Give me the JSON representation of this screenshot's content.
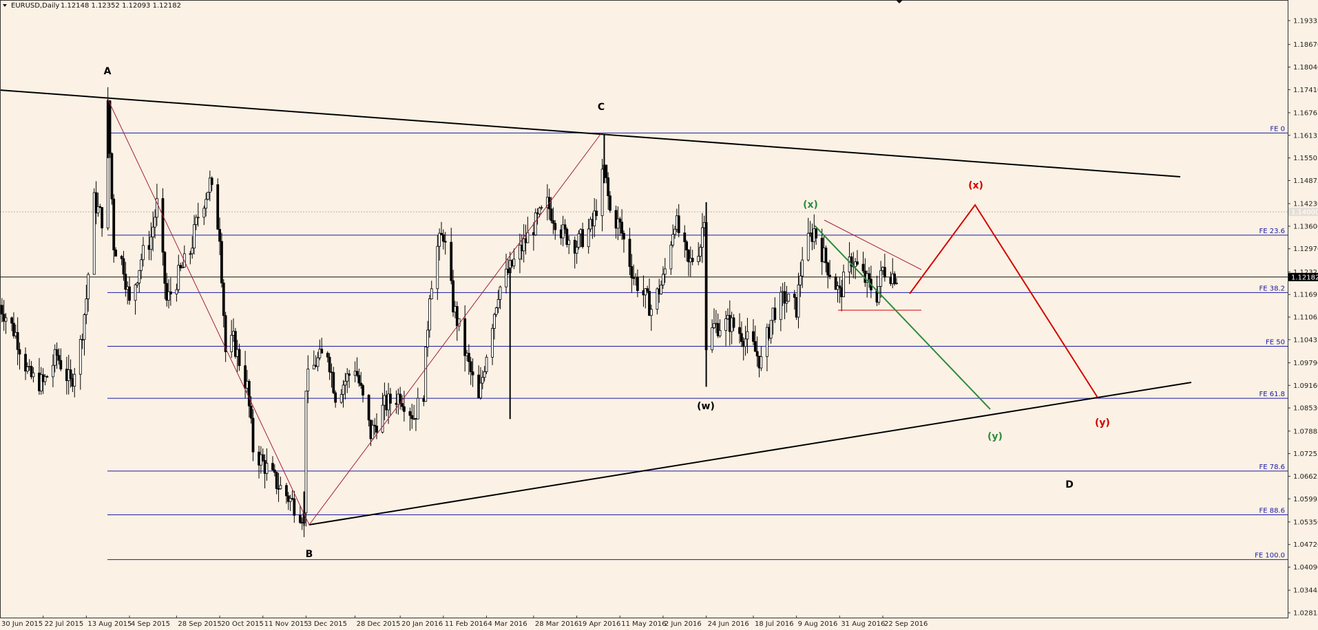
{
  "header": {
    "symbol": "EURUSD,Daily",
    "ohlc": "1.12148 1.12352 1.12093 1.12182",
    "triangle_icon": "dropdown-triangle-icon"
  },
  "price_scale": {
    "ticks": [
      "1.19335",
      "1.18670",
      "1.18040",
      "1.17410",
      "1.16765",
      "1.16135",
      "1.15505",
      "1.14875",
      "1.14230",
      "1.13600",
      "1.12970",
      "1.12325",
      "1.11695",
      "1.11065",
      "1.10435",
      "1.09790",
      "1.09160",
      "1.08530",
      "1.07885",
      "1.07255",
      "1.06625",
      "1.05995",
      "1.05350",
      "1.04720",
      "1.04090",
      "1.03445",
      "1.02815"
    ],
    "current_price_label": "1.12182",
    "ask_label": "1.14000"
  },
  "time_axis": {
    "labels": [
      "30 Jun 2015",
      "22 Jul 2015",
      "13 Aug 2015",
      "4 Sep 2015",
      "28 Sep 2015",
      "20 Oct 2015",
      "11 Nov 2015",
      "3 Dec 2015",
      "28 Dec 2015",
      "20 Jan 2016",
      "11 Feb 2016",
      "4 Mar 2016",
      "28 Mar 2016",
      "19 Apr 2016",
      "11 May 2016",
      "2 Jun 2016",
      "24 Jun 2016",
      "18 Jul 2016",
      "9 Aug 2016",
      "31 Aug 2016",
      "22 Sep 2016"
    ]
  },
  "fib_levels": [
    {
      "label": "FE 0",
      "price": 1.162
    },
    {
      "label": "FE 23.6",
      "price": 1.1335
    },
    {
      "label": "FE 38.2",
      "price": 1.1175
    },
    {
      "label": "FE 50",
      "price": 1.1025
    },
    {
      "label": "FE 61.8",
      "price": 1.088
    },
    {
      "label": "FE 78.6",
      "price": 1.0677
    },
    {
      "label": "FE 88.6",
      "price": 1.0555
    },
    {
      "label": "FE 100.0",
      "price": 1.043
    }
  ],
  "wave_labels": [
    {
      "text": "A",
      "color": "#000000"
    },
    {
      "text": "B",
      "color": "#000000"
    },
    {
      "text": "C",
      "color": "#000000"
    },
    {
      "text": "D",
      "color": "#000000"
    },
    {
      "text": "(w)",
      "color": "#000000"
    },
    {
      "text": "(x)",
      "color": "#2e8b3e"
    },
    {
      "text": "(y)",
      "color": "#2e8b3e"
    },
    {
      "text": "(x)",
      "color": "#d40000"
    },
    {
      "text": "(y)",
      "color": "#d40000"
    }
  ],
  "colors": {
    "background": "#fbf1e4",
    "fib_line": "#1a1aa6",
    "trendline": "#000000",
    "wave_red": "#d40000",
    "wave_green": "#2e8b3e",
    "abc_line": "#a0203a"
  },
  "chart_data": {
    "type": "candlestick",
    "title": "EURUSD,Daily",
    "ylim": [
      1.02815,
      1.196
    ],
    "x_range": [
      "30 Jun 2015",
      "14 Dec 2016"
    ],
    "last_close": 1.12182,
    "series": [
      {
        "name": "price path",
        "points": [
          [
            "30 Jun 2015",
            1.114
          ],
          [
            "8 Jul 2015",
            1.106
          ],
          [
            "15 Jul 2015",
            1.094
          ],
          [
            "22 Jul 2015",
            1.092
          ],
          [
            "29 Jul 2015",
            1.1
          ],
          [
            "5 Aug 2015",
            1.092
          ],
          [
            "10 Aug 2015",
            1.103
          ],
          [
            "13 Aug 2015",
            1.116
          ],
          [
            "17 Aug 2015",
            1.143
          ],
          [
            "21 Aug 2015",
            1.138
          ],
          [
            "24 Aug 2015",
            1.169
          ],
          [
            "27 Aug 2015",
            1.131
          ],
          [
            "1 Sep 2015",
            1.125
          ],
          [
            "4 Sep 2015",
            1.114
          ],
          [
            "10 Sep 2015",
            1.127
          ],
          [
            "15 Sep 2015",
            1.133
          ],
          [
            "18 Sep 2015",
            1.142
          ],
          [
            "23 Sep 2015",
            1.115
          ],
          [
            "28 Sep 2015",
            1.121
          ],
          [
            "5 Oct 2015",
            1.129
          ],
          [
            "9 Oct 2015",
            1.139
          ],
          [
            "15 Oct 2015",
            1.148
          ],
          [
            "20 Oct 2015",
            1.134
          ],
          [
            "23 Oct 2015",
            1.101
          ],
          [
            "27 Oct 2015",
            1.104
          ],
          [
            "3 Nov 2015",
            1.091
          ],
          [
            "6 Nov 2015",
            1.074
          ],
          [
            "11 Nov 2015",
            1.07
          ],
          [
            "17 Nov 2015",
            1.065
          ],
          [
            "23 Nov 2015",
            1.061
          ],
          [
            "26 Nov 2015",
            1.059
          ],
          [
            "2 Dec 2015",
            1.055
          ],
          [
            "3 Dec 2015",
            1.092
          ],
          [
            "8 Dec 2015",
            1.098
          ],
          [
            "14 Dec 2015",
            1.101
          ],
          [
            "18 Dec 2015",
            1.089
          ],
          [
            "28 Dec 2015",
            1.097
          ],
          [
            "5 Jan 2016",
            1.078
          ],
          [
            "12 Jan 2016",
            1.086
          ],
          [
            "20 Jan 2016",
            1.089
          ],
          [
            "27 Jan 2016",
            1.083
          ],
          [
            "1 Feb 2016",
            1.09
          ],
          [
            "4 Feb 2016",
            1.118
          ],
          [
            "8 Feb 2016",
            1.13
          ],
          [
            "11 Feb 2016",
            1.134
          ],
          [
            "16 Feb 2016",
            1.114
          ],
          [
            "22 Feb 2016",
            1.101
          ],
          [
            "29 Feb 2016",
            1.087
          ],
          [
            "4 Mar 2016",
            1.101
          ],
          [
            "10 Mar 2016",
            1.118
          ],
          [
            "18 Mar 2016",
            1.126
          ],
          [
            "28 Mar 2016",
            1.136
          ],
          [
            "4 Apr 2016",
            1.142
          ],
          [
            "12 Apr 2016",
            1.134
          ],
          [
            "19 Apr 2016",
            1.131
          ],
          [
            "27 Apr 2016",
            1.136
          ],
          [
            "3 May 2016",
            1.152
          ],
          [
            "6 May 2016",
            1.14
          ],
          [
            "11 May 2016",
            1.136
          ],
          [
            "18 May 2016",
            1.122
          ],
          [
            "27 May 2016",
            1.113
          ],
          [
            "2 Jun 2016",
            1.121
          ],
          [
            "8 Jun 2016",
            1.138
          ],
          [
            "15 Jun 2016",
            1.125
          ],
          [
            "21 Jun 2016",
            1.131
          ],
          [
            "23 Jun 2016",
            1.14
          ],
          [
            "24 Jun 2016",
            1.103
          ],
          [
            "28 Jun 2016",
            1.108
          ],
          [
            "6 Jul 2016",
            1.109
          ],
          [
            "12 Jul 2016",
            1.106
          ],
          [
            "18 Jul 2016",
            1.102
          ],
          [
            "22 Jul 2016",
            1.098
          ],
          [
            "28 Jul 2016",
            1.112
          ],
          [
            "3 Aug 2016",
            1.116
          ],
          [
            "9 Aug 2016",
            1.113
          ],
          [
            "12 Aug 2016",
            1.128
          ],
          [
            "18 Aug 2016",
            1.135
          ],
          [
            "24 Aug 2016",
            1.126
          ],
          [
            "31 Aug 2016",
            1.117
          ],
          [
            "6 Sep 2016",
            1.127
          ],
          [
            "13 Sep 2016",
            1.121
          ],
          [
            "19 Sep 2016",
            1.117
          ],
          [
            "22 Sep 2016",
            1.124
          ],
          [
            "29 Sep 2016",
            1.122
          ]
        ]
      },
      {
        "name": "red wave path",
        "points": [
          [
            "29 Sep 2016",
            1.1185
          ],
          [
            "18 Oct 2016",
            1.141
          ],
          [
            "18 Nov 2016",
            1.088
          ]
        ]
      },
      {
        "name": "green wave path",
        "points": [
          [
            "15 Aug 2016",
            1.1365
          ],
          [
            "19 Oct 2016",
            1.0845
          ]
        ]
      }
    ],
    "annotations": [
      "A",
      "B",
      "C",
      "D",
      "(w)",
      "(x)",
      "(y)",
      "(x)",
      "(y)"
    ]
  }
}
